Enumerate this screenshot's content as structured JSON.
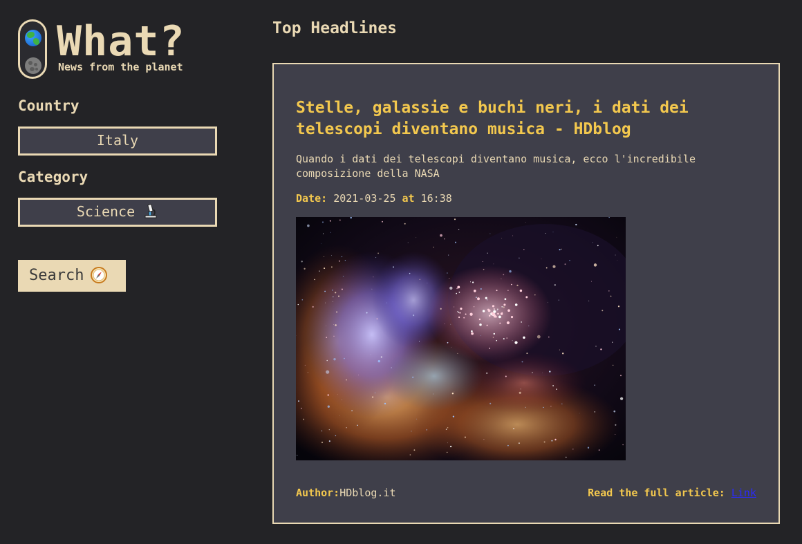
{
  "logo": {
    "title": "What?",
    "subtitle": "News from the planet"
  },
  "filters": {
    "country_label": "Country",
    "country_value": "Italy",
    "category_label": "Category",
    "category_value": "Science",
    "search_label": "Search"
  },
  "main": {
    "heading": "Top Headlines",
    "article": {
      "title": "Stelle, galassie e buchi neri, i dati dei telescopi diventano musica - HDblog",
      "description": "Quando i dati dei telescopi diventano musica, ecco l'incredibile composizione della NASA",
      "date_label": "Date:",
      "date_value": "2021-03-25",
      "at_label": "at",
      "time_value": "16:38",
      "author_label": "Author:",
      "author_value": "HDblog.it",
      "read_label": "Read the full article:",
      "link_text": "Link"
    }
  },
  "icons": {
    "logo_top": "globe-icon",
    "logo_bottom": "moon-icon",
    "category": "microscope-icon",
    "search": "compass-icon"
  },
  "colors": {
    "background": "#232326",
    "panel": "#3f3f4a",
    "cream": "#ead9b4",
    "accent": "#f3c84e",
    "link": "#2a2aff"
  }
}
